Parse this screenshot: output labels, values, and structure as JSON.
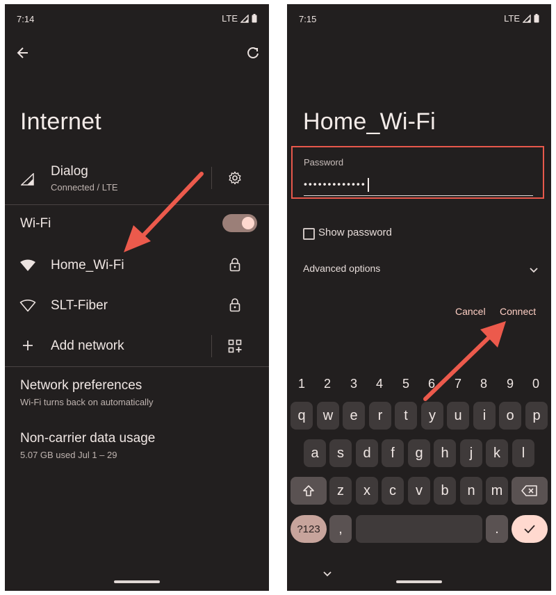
{
  "left": {
    "status": {
      "time": "7:14",
      "network": "LTE"
    },
    "title": "Internet",
    "mobile": {
      "name": "Dialog",
      "status": "Connected / LTE"
    },
    "wifi": {
      "label": "Wi-Fi",
      "enabled": true
    },
    "networks": [
      {
        "name": "Home_Wi-Fi",
        "secured": true
      },
      {
        "name": "SLT-Fiber",
        "secured": true
      }
    ],
    "add_network": "Add network",
    "preferences": {
      "title": "Network preferences",
      "subtitle": "Wi-Fi turns back on automatically"
    },
    "data_usage": {
      "title": "Non-carrier data usage",
      "subtitle": "5.07 GB used Jul 1 – 29"
    }
  },
  "right": {
    "status": {
      "time": "7:15",
      "network": "LTE"
    },
    "title": "Home_Wi-Fi",
    "password": {
      "label": "Password",
      "value": "•••••••••••••"
    },
    "show_password": "Show password",
    "advanced_options": "Advanced options",
    "cancel": "Cancel",
    "connect": "Connect",
    "keyboard": {
      "numbers": [
        "1",
        "2",
        "3",
        "4",
        "5",
        "6",
        "7",
        "8",
        "9",
        "0"
      ],
      "row1": [
        "q",
        "w",
        "e",
        "r",
        "t",
        "y",
        "u",
        "i",
        "o",
        "p"
      ],
      "row2": [
        "a",
        "s",
        "d",
        "f",
        "g",
        "h",
        "j",
        "k",
        "l"
      ],
      "row3": [
        "z",
        "x",
        "c",
        "v",
        "b",
        "n",
        "m"
      ],
      "symbols": "?123",
      "comma": ",",
      "period": "."
    }
  },
  "colors": {
    "background": "#221f1f",
    "accent": "#ffd9cf",
    "highlight": "#e8584b",
    "toggle_track": "#9b7f78"
  }
}
